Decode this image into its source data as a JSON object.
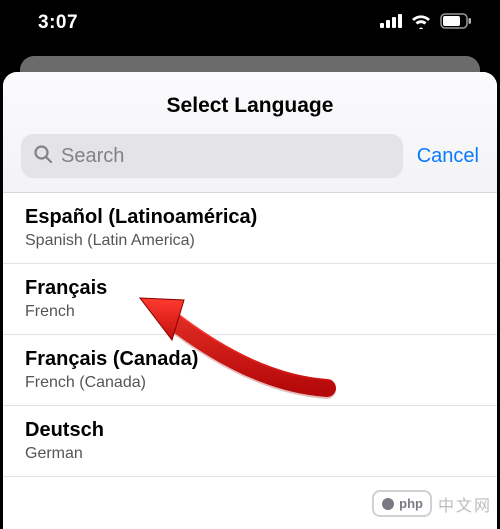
{
  "status": {
    "time": "3:07"
  },
  "sheet": {
    "title": "Select Language",
    "search_placeholder": "Search",
    "cancel_label": "Cancel"
  },
  "languages": [
    {
      "primary": "Español (Latinoamérica)",
      "secondary": "Spanish (Latin America)"
    },
    {
      "primary": "Français",
      "secondary": "French"
    },
    {
      "primary": "Français (Canada)",
      "secondary": "French (Canada)"
    },
    {
      "primary": "Deutsch",
      "secondary": "German"
    }
  ],
  "watermark": {
    "badge": "php",
    "text": "中文网"
  }
}
